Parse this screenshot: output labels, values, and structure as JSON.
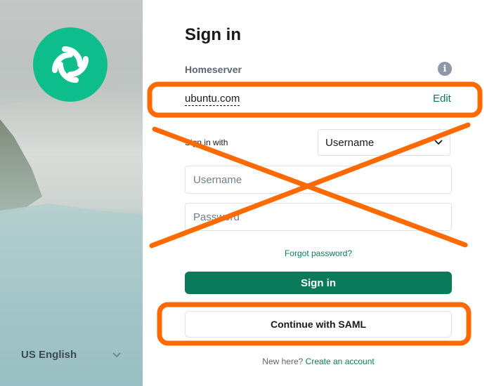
{
  "left": {
    "language_label": "US English"
  },
  "auth": {
    "title": "Sign in",
    "homeserver_heading": "Homeserver",
    "homeserver_name": "ubuntu.com",
    "edit_label": "Edit",
    "sign_in_with_label": "Sign in with",
    "login_type_value": "Username",
    "username_placeholder": "Username",
    "password_placeholder": "Password",
    "forgot_password": "Forgot password?",
    "sign_in_button": "Sign in",
    "saml_button": "Continue with SAML",
    "new_here_text": "New here?",
    "create_account": "Create an account"
  },
  "colors": {
    "brand_green": "#0dbd8b",
    "accent_dark_green": "#0b7a5b",
    "annotation_orange": "#ff6a00"
  },
  "icons": {
    "logo": "element-logo",
    "info": "info-icon",
    "chevron": "chevron-down-icon"
  }
}
